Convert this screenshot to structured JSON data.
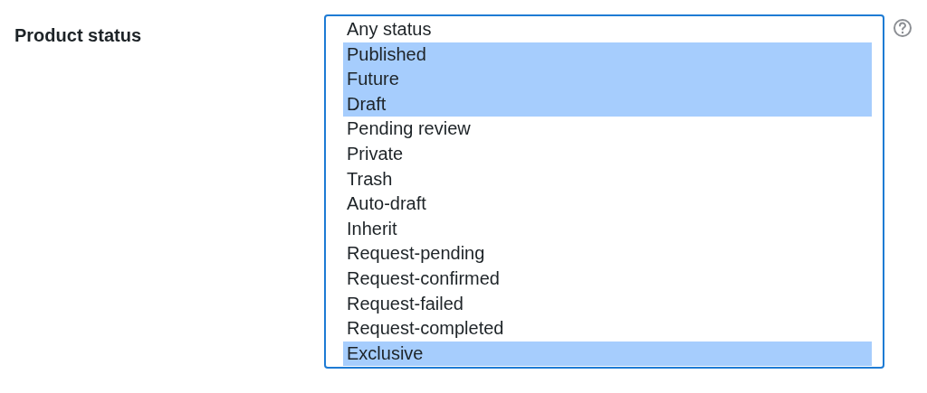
{
  "field": {
    "label": "Product status"
  },
  "options": [
    {
      "label": "Any status",
      "selected": false
    },
    {
      "label": "Published",
      "selected": true
    },
    {
      "label": "Future",
      "selected": true
    },
    {
      "label": "Draft",
      "selected": true
    },
    {
      "label": "Pending review",
      "selected": false
    },
    {
      "label": "Private",
      "selected": false
    },
    {
      "label": "Trash",
      "selected": false
    },
    {
      "label": "Auto-draft",
      "selected": false
    },
    {
      "label": "Inherit",
      "selected": false
    },
    {
      "label": "Request-pending",
      "selected": false
    },
    {
      "label": "Request-confirmed",
      "selected": false
    },
    {
      "label": "Request-failed",
      "selected": false
    },
    {
      "label": "Request-completed",
      "selected": false
    },
    {
      "label": "Exclusive",
      "selected": true
    }
  ]
}
